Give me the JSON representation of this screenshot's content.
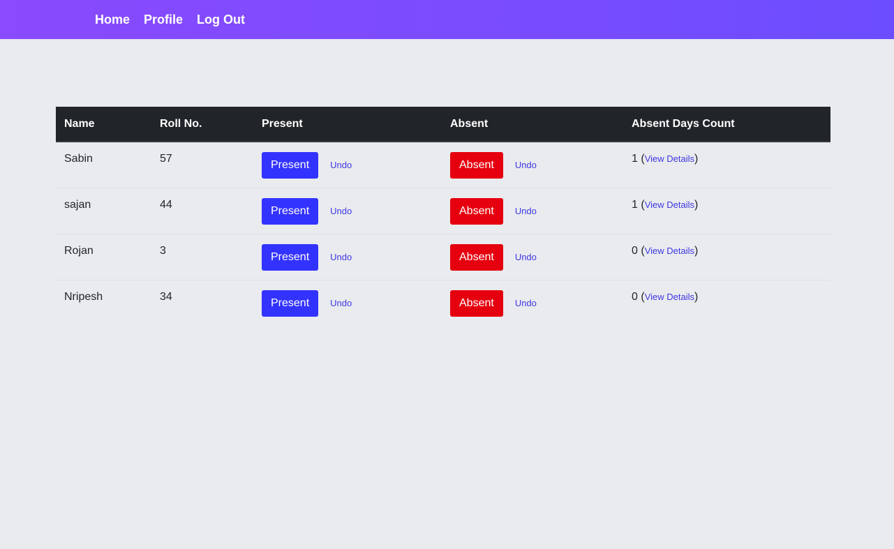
{
  "nav": {
    "home": "Home",
    "profile": "Profile",
    "logout": "Log Out"
  },
  "table": {
    "headers": {
      "name": "Name",
      "roll": "Roll No.",
      "present": "Present",
      "absent": "Absent",
      "count": "Absent Days Count"
    },
    "rows": [
      {
        "name": "Sabin",
        "roll": "57",
        "present_label": "Present",
        "present_undo": "Undo",
        "absent_label": "Absent",
        "absent_undo": "Undo",
        "count": "1",
        "details": "View Details"
      },
      {
        "name": "sajan",
        "roll": "44",
        "present_label": "Present",
        "present_undo": "Undo",
        "absent_label": "Absent",
        "absent_undo": "Undo",
        "count": "1",
        "details": "View Details"
      },
      {
        "name": "Rojan",
        "roll": "3",
        "present_label": "Present",
        "present_undo": "Undo",
        "absent_label": "Absent",
        "absent_undo": "Undo",
        "count": "0",
        "details": "View Details"
      },
      {
        "name": "Nripesh",
        "roll": "34",
        "present_label": "Present",
        "present_undo": "Undo",
        "absent_label": "Absent",
        "absent_undo": "Undo",
        "count": "0",
        "details": "View Details"
      }
    ]
  },
  "colors": {
    "nav_gradient_start": "#8a4afd",
    "nav_gradient_end": "#6c4dff",
    "present_button": "#3333ff",
    "absent_button": "#e6000f",
    "link": "#3f37e4",
    "header_bg": "#212529",
    "page_bg": "#e9ebee"
  }
}
